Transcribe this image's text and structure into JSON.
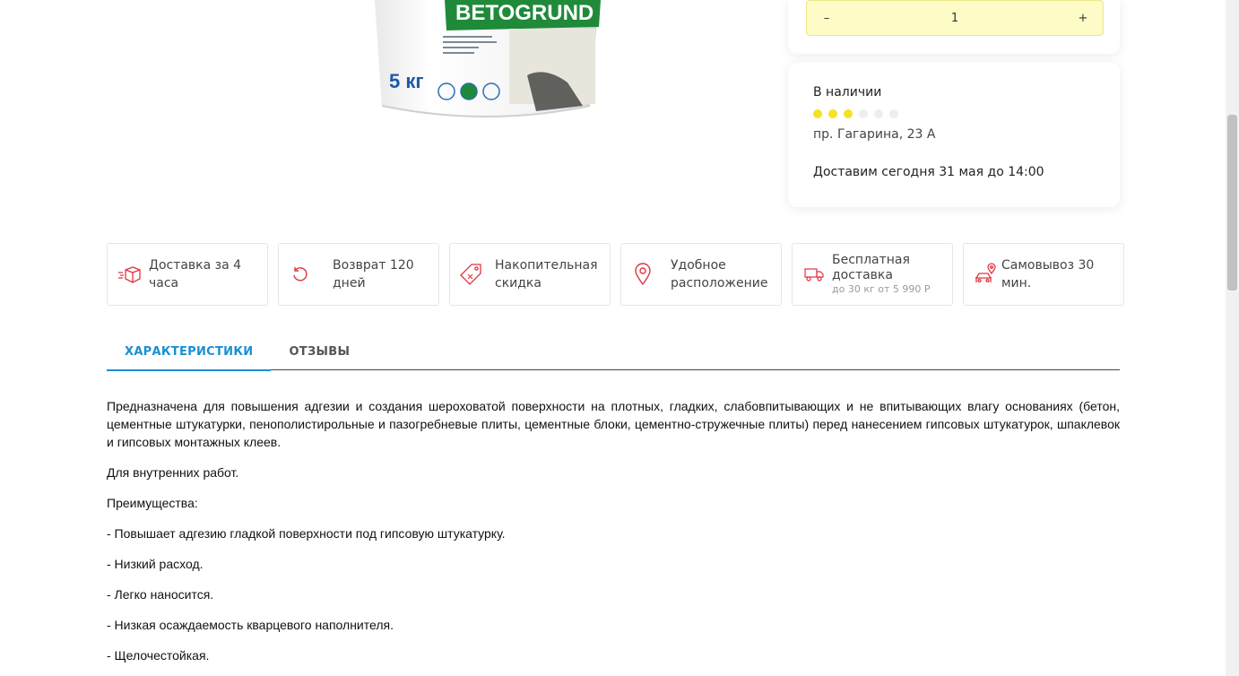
{
  "product": {
    "brand_label": "BETOGRUND",
    "weight_label": "5 кг"
  },
  "quantity": {
    "minus": "–",
    "value": "1",
    "plus": "+"
  },
  "stock": {
    "title": "В наличии",
    "level_filled": 3,
    "level_total": 6,
    "address": "пр. Гагарина, 23 А",
    "delivery": "Доставим сегодня 31 мая до 14:00"
  },
  "features": [
    {
      "icon": "box-icon",
      "lines": [
        "Доставка за 4 часа"
      ]
    },
    {
      "icon": "return-icon",
      "lines": [
        "Возврат 120 дней"
      ]
    },
    {
      "icon": "tag-icon",
      "lines": [
        "Накопительная",
        "скидка"
      ]
    },
    {
      "icon": "location-pin-icon",
      "lines": [
        "Удобное",
        "расположение"
      ]
    },
    {
      "icon": "truck-icon",
      "lines": [
        "Бесплатная",
        "доставка"
      ],
      "sub": "до 30 кг от 5 990 Р"
    },
    {
      "icon": "car-pickup-icon",
      "lines": [
        "Самовывоз 30 мин."
      ]
    }
  ],
  "tabs": [
    {
      "label": "ХАРАКТЕРИСТИКИ",
      "active": true
    },
    {
      "label": "ОТЗЫВЫ",
      "active": false
    }
  ],
  "description": [
    "Предназначена для повышения адгезии и создания шероховатой поверхности на плотных, гладких, слабовпитывающих и не впитывающих влагу основаниях (бетон, цементные штукатурки, пенополистирольные и пазогребневые плиты, цементные блоки, цементно-стружечные плиты) перед нанесением гипсовых штукатурок, шпаклевок и гипсовых монтажных клеев.",
    "Для внутренних работ.",
    "Преимущества:",
    "- Повышает адгезию гладкой поверхности под гипсовую штукатурку.",
    "- Низкий расход.",
    "- Легко наносится.",
    "- Низкая осаждаемость кварцевого наполнителя.",
    "- Щелочестойкая."
  ],
  "colors": {
    "accent": "#1a8fd0",
    "icon_red": "#e0343f",
    "dot_on": "#f2e422",
    "qty_bg": "#fdfcc6",
    "bucket_green": "#1f8a3a"
  }
}
